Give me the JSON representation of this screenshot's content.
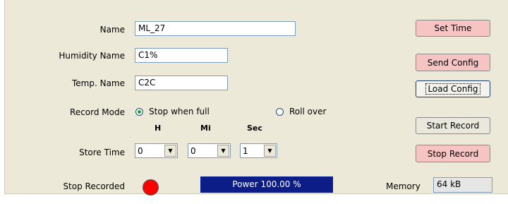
{
  "config": {
    "name_label": "Name",
    "name_value": "ML_27",
    "humidity_label": "Humidity Name",
    "humidity_value": "C1%",
    "temp_label": "Temp. Name",
    "temp_value": "C2C",
    "record_mode_label": "Record Mode",
    "record_mode_options": [
      {
        "label": "Stop when full",
        "selected": true
      },
      {
        "label": "Roll over",
        "selected": false
      }
    ],
    "store_time_label": "Store Time",
    "store_time_headers": [
      "H",
      "Mi",
      "Sec"
    ],
    "store_time_values": [
      "0",
      "0",
      "1"
    ]
  },
  "status": {
    "stop_recorded_label": "Stop Recorded",
    "led_color": "#ff0000",
    "power_text": "Power  100.00 %",
    "power_bar_color": "#0c1d87",
    "memory_label": "Memory",
    "memory_value": "64 kB"
  },
  "buttons": {
    "set_time": "Set Time",
    "send_config": "Send Config",
    "load_config": "Load Config",
    "start_record": "Start Record",
    "stop_record": "Stop Record"
  },
  "colors": {
    "panel_bg": "#ece9d8",
    "pink_button": "#f7c4c4"
  }
}
